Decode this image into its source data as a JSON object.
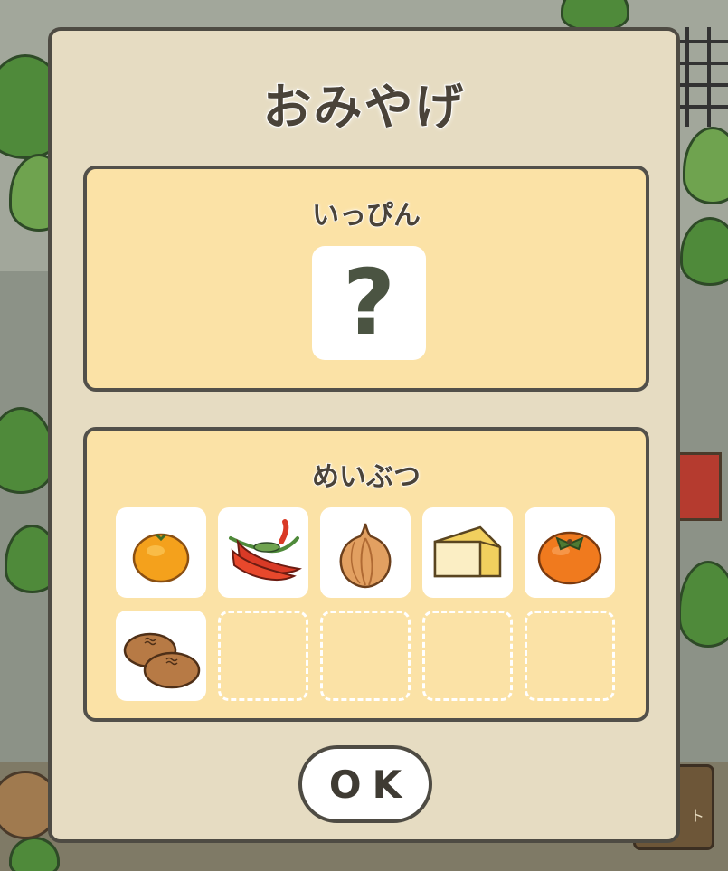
{
  "dialog": {
    "title": "おみやげ"
  },
  "specialty": {
    "label": "いっぴん",
    "slot_icon": "question-mark-icon",
    "slot_text": "?"
  },
  "souvenirs": {
    "label": "めいぶつ",
    "items": [
      {
        "name": "mandarin-orange-icon",
        "filled": true
      },
      {
        "name": "red-chili-peppers-icon",
        "filled": true
      },
      {
        "name": "onion-icon",
        "filled": true
      },
      {
        "name": "cheese-wedge-icon",
        "filled": true
      },
      {
        "name": "persimmon-icon",
        "filled": true
      },
      {
        "name": "steamed-buns-icon",
        "filled": true
      },
      {
        "name": "empty-slot",
        "filled": false
      },
      {
        "name": "empty-slot",
        "filled": false
      },
      {
        "name": "empty-slot",
        "filled": false
      },
      {
        "name": "empty-slot",
        "filled": false
      }
    ]
  },
  "ok_button": {
    "label": "OK"
  },
  "background": {
    "board_text": "ト"
  },
  "colors": {
    "dialog_bg": "#e6dcc2",
    "panel_bg": "#fbe2a6",
    "border": "#4e4b43",
    "text": "#4a4339"
  }
}
